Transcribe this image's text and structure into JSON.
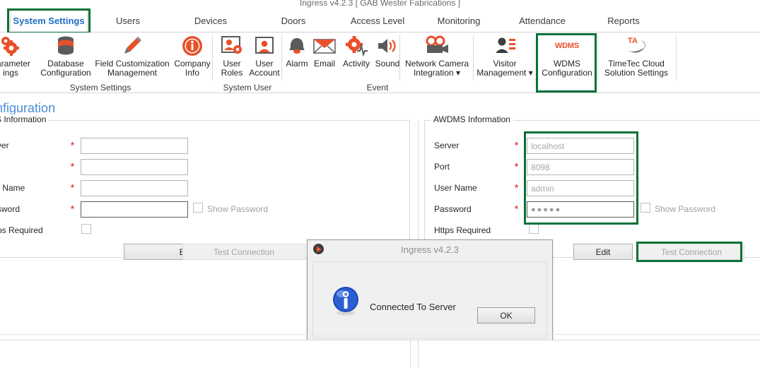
{
  "window": {
    "title": "Ingress v4.2.3  [ GAB Wester Fabrications ]"
  },
  "tabs": [
    {
      "label": "System Settings",
      "active": true,
      "highlighted": true
    },
    {
      "label": "Users",
      "active": false,
      "highlighted": false
    },
    {
      "label": "Devices",
      "active": false,
      "highlighted": false
    },
    {
      "label": "Doors",
      "active": false,
      "highlighted": false
    },
    {
      "label": "Access Level",
      "active": false,
      "highlighted": false
    },
    {
      "label": "Monitoring",
      "active": false,
      "highlighted": false
    },
    {
      "label": "Attendance",
      "active": false,
      "highlighted": false
    },
    {
      "label": "Reports",
      "active": false,
      "highlighted": false
    }
  ],
  "ribbon": {
    "groups": [
      {
        "name": "System Settings",
        "items": [
          {
            "label": "Parameter\nings",
            "icon": "gear-settings-icon"
          },
          {
            "label": "Database\nConfiguration",
            "icon": "database-icon"
          },
          {
            "label": "Field Customization\nManagement",
            "icon": "pencil-icon"
          },
          {
            "label": "Company\nInfo",
            "icon": "info-circle-icon"
          }
        ]
      },
      {
        "name": "System User",
        "items": [
          {
            "label": "User\nRoles",
            "icon": "user-roles-icon"
          },
          {
            "label": "User\nAccount",
            "icon": "user-account-icon"
          }
        ]
      },
      {
        "name": "Event",
        "items": [
          {
            "label": "Alarm",
            "icon": "bell-icon"
          },
          {
            "label": "Email",
            "icon": "envelope-icon"
          },
          {
            "label": "Activity",
            "icon": "activity-gear-icon"
          },
          {
            "label": "Sound",
            "icon": "speaker-icon"
          },
          {
            "label": "Network Camera\nIntegration ▾",
            "icon": "camera-icon"
          }
        ]
      },
      {
        "name": "",
        "items": [
          {
            "label": "Visitor\nManagement ▾",
            "icon": "visitor-icon"
          },
          {
            "label": "WDMS\nConfiguration",
            "icon": "wdms-icon",
            "highlighted": true
          },
          {
            "label": "TimeTec Cloud\nSolution Settings",
            "icon": "timetec-icon"
          }
        ]
      }
    ]
  },
  "page": {
    "title": "S Configuration",
    "left_panel": {
      "legend": "S Information",
      "fields": [
        {
          "label": "ver",
          "required": true,
          "value": "",
          "placeholder": ""
        },
        {
          "label": ":",
          "required": true,
          "value": "",
          "placeholder": ""
        },
        {
          "label": "r Name",
          "required": true,
          "value": "",
          "placeholder": ""
        },
        {
          "label": "sword",
          "required": true,
          "value": "",
          "placeholder": "",
          "masked": true
        }
      ],
      "show_password_label": "Show Password",
      "show_password_checked": false,
      "https_label": "os Required",
      "https_checked": false,
      "edit_button": "Edit",
      "test_button": "Test Connection",
      "test_button_disabled": true
    },
    "right_panel": {
      "legend": "AWDMS Information",
      "fields": [
        {
          "label": "Server",
          "required": true,
          "value": "localhost",
          "is_placeholder": true
        },
        {
          "label": "Port",
          "required": true,
          "value": "8098",
          "is_placeholder": true
        },
        {
          "label": "User Name",
          "required": true,
          "value": "admin",
          "is_placeholder": true
        },
        {
          "label": "Password",
          "required": true,
          "value": "●●●●●",
          "masked": true
        }
      ],
      "show_password_label": "Show Password",
      "show_password_checked": false,
      "https_label": "Https Required",
      "https_checked": false,
      "edit_button": "Edit",
      "test_button": "Test Connection",
      "test_button_disabled": true,
      "test_button_highlighted": true
    }
  },
  "dialog": {
    "title": "Ingress v4.2.3",
    "message": "Connected To Server",
    "ok_button": "OK",
    "icon": "info-icon",
    "titlebar_icon": "ingress-play-icon"
  },
  "colors": {
    "accent_orange": "#e8502a",
    "highlight_green": "#0a7038",
    "title_blue": "#4a8cd6",
    "active_tab_blue": "#1f6fc4",
    "required_red": "#e24444"
  }
}
